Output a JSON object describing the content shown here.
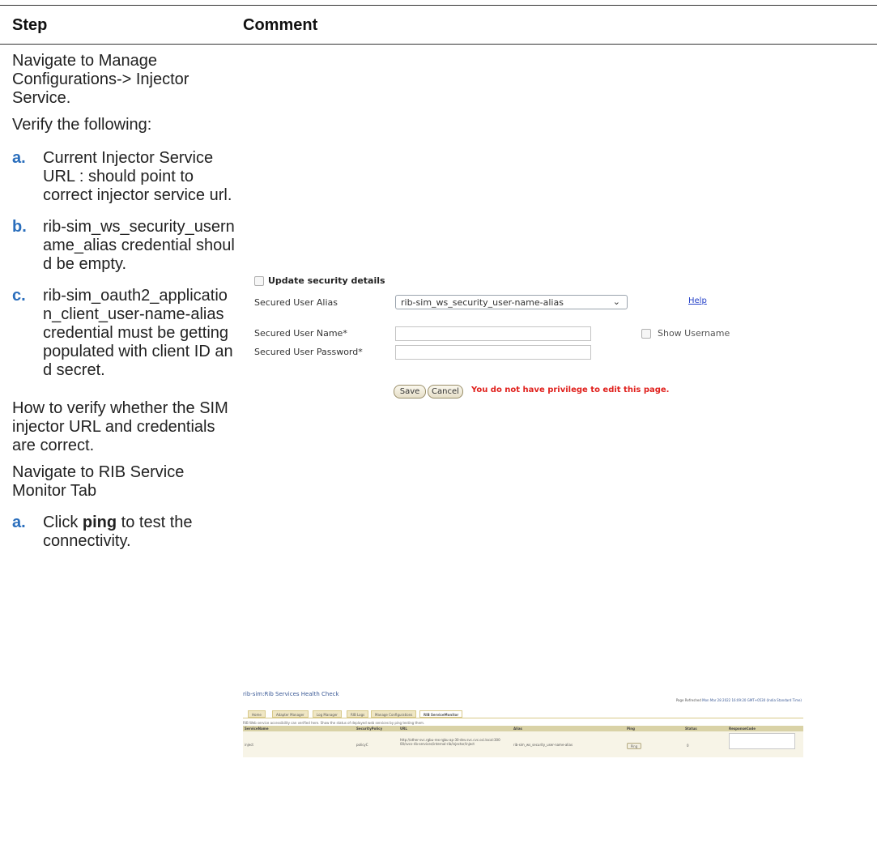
{
  "header": {
    "step": "Step",
    "comment": "Comment"
  },
  "step": {
    "intro": "Navigate to Manage Configurations-> Injector Service.",
    "verify": "Verify the following:",
    "items": [
      {
        "label": "a.",
        "text": "Current Injector Service URL : should point to correct injector service url."
      },
      {
        "label": "b.",
        "text": "rib-sim_ws_security_username_alias credential should be empty."
      },
      {
        "label": "c.",
        "text": "rib-sim_oauth2_application_client_user-name-alias credential must be getting populated with client ID and secret."
      }
    ],
    "howto": "How to verify whether the SIM injector URL and credentials are correct.",
    "navigate": "Navigate to RIB Service Monitor Tab",
    "final_item": {
      "label": "a.",
      "pre": "Click ",
      "bold": "ping",
      "post": " to test the connectivity."
    }
  },
  "security_panel": {
    "update_label": "Update security details",
    "alias_label": "Secured User Alias",
    "alias_value": "rib-sim_ws_security_user-name-alias",
    "help_link": "Help",
    "username_label": "Secured User Name*",
    "password_label": "Secured User Password*",
    "show_username": "Show Username",
    "save": "Save",
    "cancel": "Cancel",
    "error": "You do not have privilege to edit this page."
  },
  "health_check": {
    "title": "rib-sim:Rib Services Health Check",
    "refresh_prefix": "Page Refreshed",
    "refresh_time": "Mon Mar 28 2022 16:09:20 GMT+0530 (India Standard Time)",
    "tabs": [
      "Home",
      "Adapter Manager",
      "Log Manager",
      "RIB Logs",
      "Manage Configurations",
      "RIB ServiceMonitor"
    ],
    "description": "RIB Web service accessibility can verified here. Show the status of deployed web services by ping testing them.",
    "columns": [
      "ServiceName",
      "SecurityPolicy",
      "URL",
      "Alias",
      "Ping",
      "Status",
      "ResponseCode"
    ],
    "row": {
      "service": "inject",
      "policy": "policyC",
      "url": "http://other-svc.rgbu-rex-rgbu-ap-30-dev.svc.cvc.oci.local:30000/svcs-rib-services/internal-rib/injector/inject",
      "alias": "rib-sim_ws_security_user-name-alias",
      "ping": "Ping",
      "status": "0"
    }
  },
  "colors": {
    "label_blue": "#2a6ebc",
    "error_red": "#e0201c",
    "link_blue": "#2440c8"
  }
}
